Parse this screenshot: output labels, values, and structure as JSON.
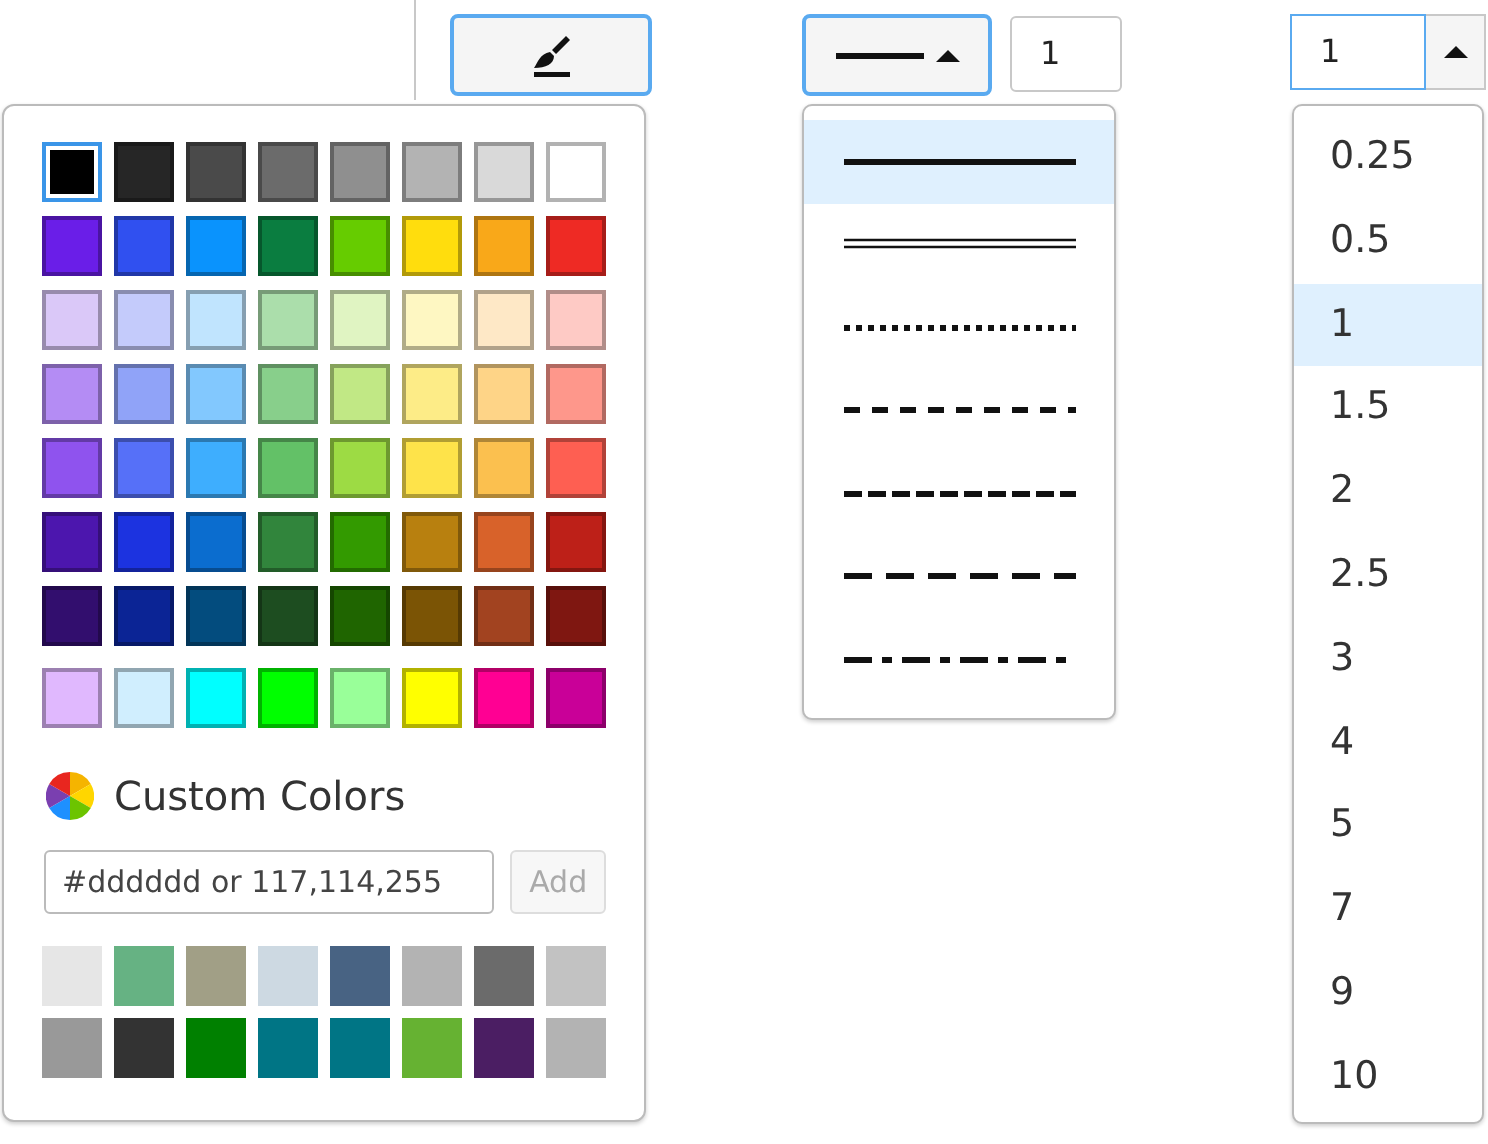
{
  "fill_button": {
    "selected": true
  },
  "palette": {
    "swatches": [
      {
        "color": "#000000",
        "selected": true
      },
      {
        "color": "#262626",
        "selected": false
      },
      {
        "color": "#4a4a4a",
        "selected": false
      },
      {
        "color": "#6b6b6b",
        "selected": false
      },
      {
        "color": "#8f8f8f",
        "selected": false
      },
      {
        "color": "#b3b3b3",
        "selected": false
      },
      {
        "color": "#d9d9d9",
        "selected": false
      },
      {
        "color": "#ffffff",
        "selected": false
      },
      {
        "color": "#6a1ee8",
        "selected": false
      },
      {
        "color": "#3050f0",
        "selected": false
      },
      {
        "color": "#0a93fd",
        "selected": false
      },
      {
        "color": "#0a7d40",
        "selected": false
      },
      {
        "color": "#66cc00",
        "selected": false
      },
      {
        "color": "#ffdd0d",
        "selected": false
      },
      {
        "color": "#f9a819",
        "selected": false
      },
      {
        "color": "#ee2a24",
        "selected": false
      },
      {
        "color": "#dac8f8",
        "selected": false
      },
      {
        "color": "#c4cbfb",
        "selected": false
      },
      {
        "color": "#c0e4fe",
        "selected": false
      },
      {
        "color": "#abdeab",
        "selected": false
      },
      {
        "color": "#e0f4c2",
        "selected": false
      },
      {
        "color": "#fef7c2",
        "selected": false
      },
      {
        "color": "#fee8c6",
        "selected": false
      },
      {
        "color": "#fecac5",
        "selected": false
      },
      {
        "color": "#b48cf4",
        "selected": false
      },
      {
        "color": "#90a3f8",
        "selected": false
      },
      {
        "color": "#82c8fe",
        "selected": false
      },
      {
        "color": "#88cf8b",
        "selected": false
      },
      {
        "color": "#c1e885",
        "selected": false
      },
      {
        "color": "#fdec87",
        "selected": false
      },
      {
        "color": "#fed487",
        "selected": false
      },
      {
        "color": "#fe978b",
        "selected": false
      },
      {
        "color": "#8f53ee",
        "selected": false
      },
      {
        "color": "#5670f8",
        "selected": false
      },
      {
        "color": "#3eaefe",
        "selected": false
      },
      {
        "color": "#63c167",
        "selected": false
      },
      {
        "color": "#9ddb44",
        "selected": false
      },
      {
        "color": "#fee34a",
        "selected": false
      },
      {
        "color": "#fbc04f",
        "selected": false
      },
      {
        "color": "#fe5f52",
        "selected": false
      },
      {
        "color": "#4c16ae",
        "selected": false
      },
      {
        "color": "#1c33e0",
        "selected": false
      },
      {
        "color": "#0b6dcf",
        "selected": false
      },
      {
        "color": "#31853c",
        "selected": false
      },
      {
        "color": "#339a00",
        "selected": false
      },
      {
        "color": "#b8800f",
        "selected": false
      },
      {
        "color": "#d8622a",
        "selected": false
      },
      {
        "color": "#bd2018",
        "selected": false
      },
      {
        "color": "#320e6e",
        "selected": false
      },
      {
        "color": "#0b2495",
        "selected": false
      },
      {
        "color": "#034c7e",
        "selected": false
      },
      {
        "color": "#1d4d20",
        "selected": false
      },
      {
        "color": "#1f6500",
        "selected": false
      },
      {
        "color": "#7b5405",
        "selected": false
      },
      {
        "color": "#a24320",
        "selected": false
      },
      {
        "color": "#7f1711",
        "selected": false
      },
      {
        "color": "#e0b8fe",
        "selected": false
      },
      {
        "color": "#d0eefe",
        "selected": false
      },
      {
        "color": "#00ffff",
        "selected": false
      },
      {
        "color": "#00ff00",
        "selected": false
      },
      {
        "color": "#99ff99",
        "selected": false
      },
      {
        "color": "#ffff00",
        "selected": false
      },
      {
        "color": "#ff0093",
        "selected": false
      },
      {
        "color": "#c90098",
        "selected": false
      }
    ],
    "custom_label": "Custom Colors",
    "custom_input": {
      "placeholder": "#dddddd or 117,114,255"
    },
    "add_button": {
      "label": "Add",
      "disabled": true
    },
    "custom_swatches": [
      {
        "color": "#e6e6e6"
      },
      {
        "color": "#66b283"
      },
      {
        "color": "#a19f86"
      },
      {
        "color": "#cdd9e2"
      },
      {
        "color": "#486383"
      },
      {
        "color": "#b3b3b3"
      },
      {
        "color": "#6b6b6b"
      },
      {
        "color": "#c2c2c2"
      },
      {
        "color": "#999999"
      },
      {
        "color": "#333333"
      },
      {
        "color": "#008000"
      },
      {
        "color": "#007585"
      },
      {
        "color": "#007585"
      },
      {
        "color": "#66b232"
      },
      {
        "color": "#4b1e63"
      },
      {
        "color": "#b3b3b3"
      }
    ]
  },
  "line_style": {
    "options": [
      {
        "kind": "solid",
        "selected": true
      },
      {
        "kind": "double",
        "selected": false
      },
      {
        "kind": "dotted",
        "selected": false
      },
      {
        "kind": "dashed",
        "selected": false
      },
      {
        "kind": "dense-dashed",
        "selected": false
      },
      {
        "kind": "long-dashed",
        "selected": false
      },
      {
        "kind": "dash-dot",
        "selected": false
      }
    ]
  },
  "width_field": {
    "value": "1"
  },
  "size_combo": {
    "value": "1",
    "options": [
      {
        "label": "0.25",
        "selected": false
      },
      {
        "label": "0.5",
        "selected": false
      },
      {
        "label": "1",
        "selected": true
      },
      {
        "label": "1.5",
        "selected": false
      },
      {
        "label": "2",
        "selected": false
      },
      {
        "label": "2.5",
        "selected": false
      },
      {
        "label": "3",
        "selected": false
      },
      {
        "label": "4",
        "selected": false
      },
      {
        "label": "5",
        "selected": false
      },
      {
        "label": "7",
        "selected": false
      },
      {
        "label": "9",
        "selected": false
      },
      {
        "label": "10",
        "selected": false
      }
    ]
  }
}
